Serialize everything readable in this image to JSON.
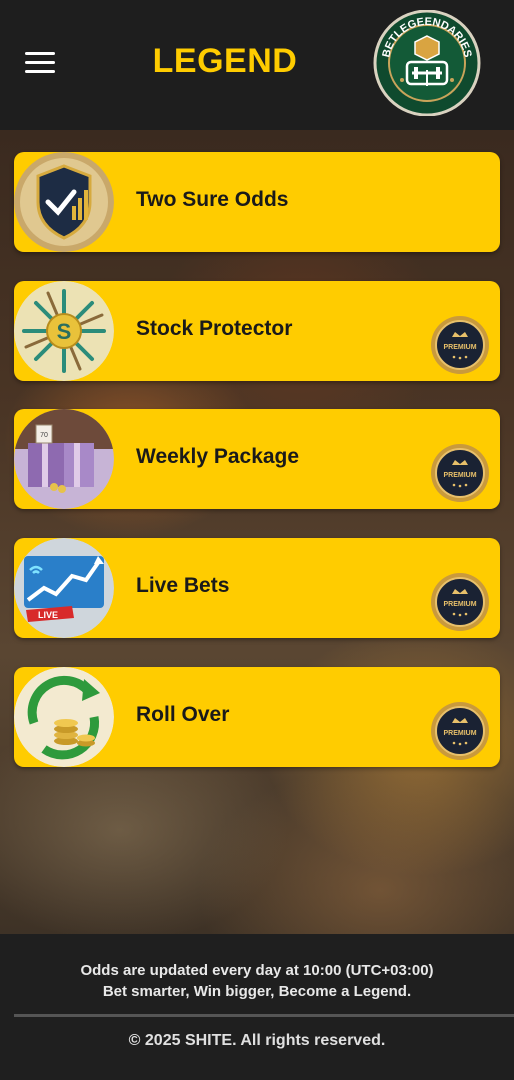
{
  "header": {
    "title": "LEGEND",
    "menu_icon": "hamburger-menu-icon",
    "logo_text": "BETLEGEENDARIES",
    "accent_color": "#FFCC00"
  },
  "cards": [
    {
      "label": "Two Sure Odds",
      "icon": "shield-chart-icon",
      "premium": false
    },
    {
      "label": "Stock Protector",
      "icon": "dollar-arrows-icon",
      "premium": true
    },
    {
      "label": "Weekly Package",
      "icon": "gift-box-icon",
      "premium": true
    },
    {
      "label": "Live Bets",
      "icon": "live-chart-icon",
      "premium": true,
      "icon_text": "LIVE"
    },
    {
      "label": "Roll Over",
      "icon": "coins-cycle-icon",
      "premium": true
    }
  ],
  "badge": {
    "text": "PREMIUM",
    "icon": "premium-crown-badge-icon"
  },
  "footer": {
    "line1": "Odds are updated every day at 10:00 (UTC+03:00)",
    "line2": "Bet smarter, Win bigger, Become a Legend.",
    "copyright": "© 2025 SHITE. All rights reserved."
  }
}
